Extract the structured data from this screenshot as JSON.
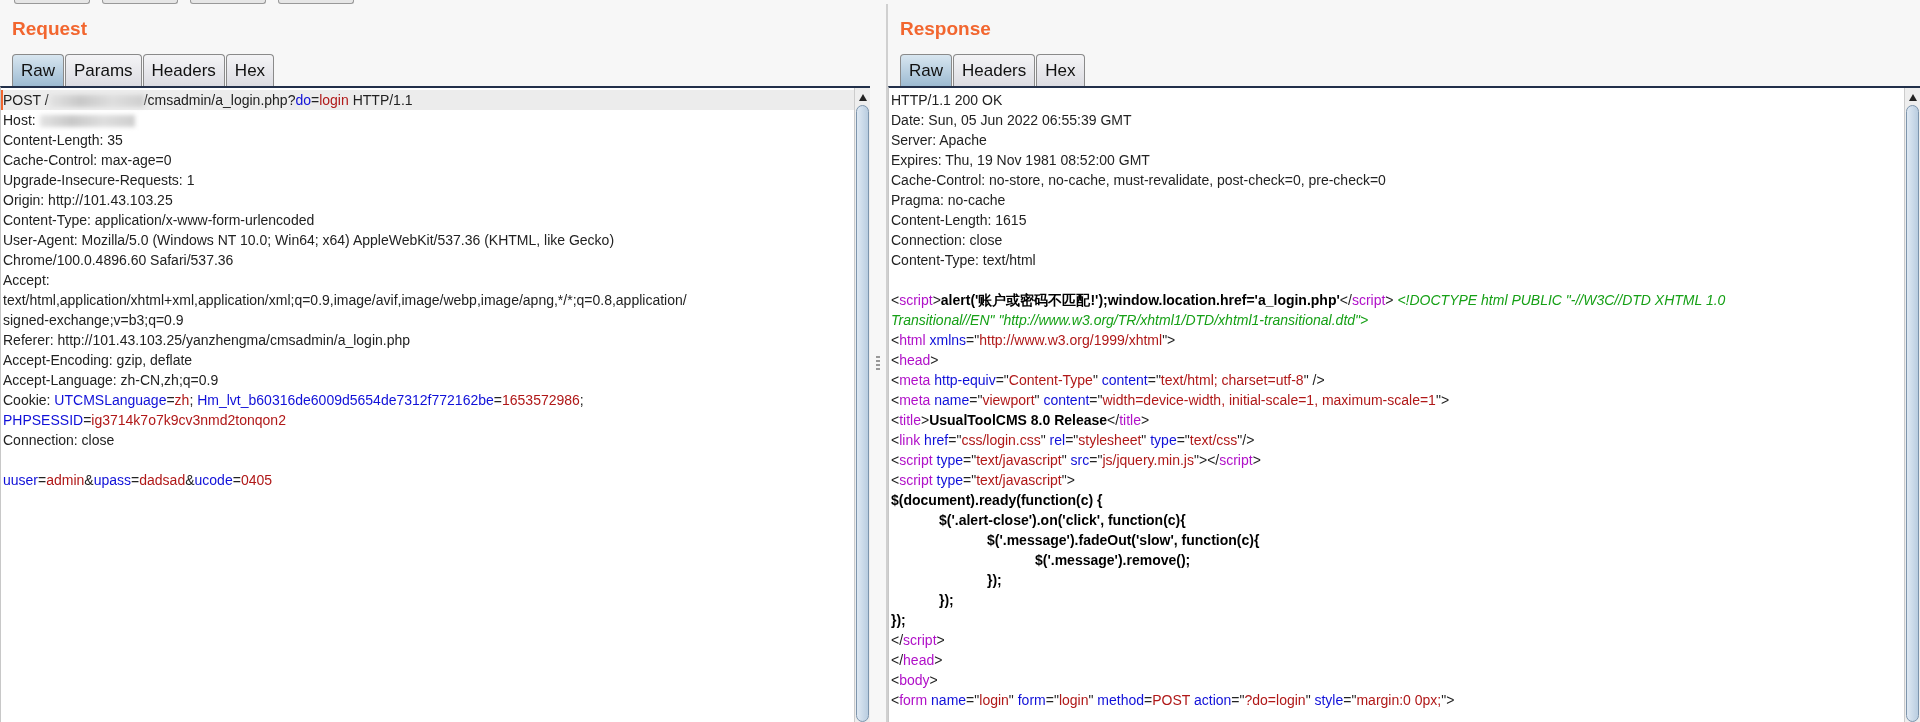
{
  "panes": [
    {
      "title": "Request",
      "tabs": [
        {
          "label": "Raw",
          "selected": true
        },
        {
          "label": "Params",
          "selected": false
        },
        {
          "label": "Headers",
          "selected": false
        },
        {
          "label": "Hex",
          "selected": false
        }
      ],
      "lines": [
        {
          "selected": true,
          "segs": [
            {
              "kind": "plain",
              "text": "POST /"
            },
            {
              "kind": "redacted"
            },
            {
              "kind": "plain",
              "text": "/cmsadmin/a_login.php?"
            },
            {
              "kind": "name",
              "text": "do"
            },
            {
              "kind": "plain",
              "text": "="
            },
            {
              "kind": "value",
              "text": "login"
            },
            {
              "kind": "plain",
              "text": " HTTP/1.1"
            }
          ]
        },
        {
          "selected": false,
          "segs": [
            {
              "kind": "plain",
              "text": "Host: "
            },
            {
              "kind": "redacted"
            }
          ]
        },
        {
          "selected": false,
          "segs": [
            {
              "kind": "plain",
              "text": "Content-Length: 35"
            }
          ]
        },
        {
          "selected": false,
          "segs": [
            {
              "kind": "plain",
              "text": "Cache-Control: max-age=0"
            }
          ]
        },
        {
          "selected": false,
          "segs": [
            {
              "kind": "plain",
              "text": "Upgrade-Insecure-Requests: 1"
            }
          ]
        },
        {
          "selected": false,
          "segs": [
            {
              "kind": "plain",
              "text": "Origin: http://101.43.103.25"
            }
          ]
        },
        {
          "selected": false,
          "segs": [
            {
              "kind": "plain",
              "text": "Content-Type: application/x-www-form-urlencoded"
            }
          ]
        },
        {
          "selected": false,
          "segs": [
            {
              "kind": "plain",
              "text": "User-Agent: Mozilla/5.0 (Windows NT 10.0; Win64; x64) AppleWebKit/537.36 (KHTML, like Gecko)"
            }
          ]
        },
        {
          "selected": false,
          "segs": [
            {
              "kind": "plain",
              "text": "Chrome/100.0.4896.60 Safari/537.36"
            }
          ]
        },
        {
          "selected": false,
          "segs": [
            {
              "kind": "plain",
              "text": "Accept:"
            }
          ]
        },
        {
          "selected": false,
          "segs": [
            {
              "kind": "plain",
              "text": "text/html,application/xhtml+xml,application/xml;q=0.9,image/avif,image/webp,image/apng,*/*;q=0.8,application/"
            }
          ]
        },
        {
          "selected": false,
          "segs": [
            {
              "kind": "plain",
              "text": "signed-exchange;v=b3;q=0.9"
            }
          ]
        },
        {
          "selected": false,
          "segs": [
            {
              "kind": "plain",
              "text": "Referer: http://101.43.103.25/yanzhengma/cmsadmin/a_login.php"
            }
          ]
        },
        {
          "selected": false,
          "segs": [
            {
              "kind": "plain",
              "text": "Accept-Encoding: gzip, deflate"
            }
          ]
        },
        {
          "selected": false,
          "segs": [
            {
              "kind": "plain",
              "text": "Accept-Language: zh-CN,zh;q=0.9"
            }
          ]
        },
        {
          "selected": false,
          "segs": [
            {
              "kind": "plain",
              "text": "Cookie: "
            },
            {
              "kind": "name",
              "text": "UTCMSLanguage"
            },
            {
              "kind": "plain",
              "text": "="
            },
            {
              "kind": "value",
              "text": "zh"
            },
            {
              "kind": "plain",
              "text": "; "
            },
            {
              "kind": "name",
              "text": "Hm_lvt_b60316de6009d5654de7312f772162be"
            },
            {
              "kind": "plain",
              "text": "="
            },
            {
              "kind": "value",
              "text": "1653572986"
            },
            {
              "kind": "plain",
              "text": ";"
            }
          ]
        },
        {
          "selected": false,
          "segs": [
            {
              "kind": "name",
              "text": "PHPSESSID"
            },
            {
              "kind": "plain",
              "text": "="
            },
            {
              "kind": "value",
              "text": "ig3714k7o7k9cv3nmd2tonqon2"
            }
          ]
        },
        {
          "selected": false,
          "segs": [
            {
              "kind": "plain",
              "text": "Connection: close"
            }
          ]
        },
        {
          "selected": false
        },
        {
          "selected": false,
          "segs": [
            {
              "kind": "name",
              "text": "uuser"
            },
            {
              "kind": "plain",
              "text": "="
            },
            {
              "kind": "value",
              "text": "admin"
            },
            {
              "kind": "plain",
              "text": "&"
            },
            {
              "kind": "name",
              "text": "upass"
            },
            {
              "kind": "plain",
              "text": "="
            },
            {
              "kind": "value",
              "text": "dadsad"
            },
            {
              "kind": "plain",
              "text": "&"
            },
            {
              "kind": "name",
              "text": "ucode"
            },
            {
              "kind": "plain",
              "text": "="
            },
            {
              "kind": "value",
              "text": "0405"
            }
          ]
        }
      ]
    },
    {
      "title": "Response",
      "tabs": [
        {
          "label": "Raw",
          "selected": true
        },
        {
          "label": "Headers",
          "selected": false
        },
        {
          "label": "Hex",
          "selected": false
        }
      ],
      "lines": [
        {
          "selected": false,
          "segs": [
            {
              "kind": "plain",
              "text": "HTTP/1.1 200 OK"
            }
          ]
        },
        {
          "selected": false,
          "segs": [
            {
              "kind": "plain",
              "text": "Date: Sun, 05 Jun 2022 06:55:39 GMT"
            }
          ]
        },
        {
          "selected": false,
          "segs": [
            {
              "kind": "plain",
              "text": "Server: Apache"
            }
          ]
        },
        {
          "selected": false,
          "segs": [
            {
              "kind": "plain",
              "text": "Expires: Thu, 19 Nov 1981 08:52:00 GMT"
            }
          ]
        },
        {
          "selected": false,
          "segs": [
            {
              "kind": "plain",
              "text": "Cache-Control: no-store, no-cache, must-revalidate, post-check=0, pre-check=0"
            }
          ]
        },
        {
          "selected": false,
          "segs": [
            {
              "kind": "plain",
              "text": "Pragma: no-cache"
            }
          ]
        },
        {
          "selected": false,
          "segs": [
            {
              "kind": "plain",
              "text": "Content-Length: 1615"
            }
          ]
        },
        {
          "selected": false,
          "segs": [
            {
              "kind": "plain",
              "text": "Connection: close"
            }
          ]
        },
        {
          "selected": false,
          "segs": [
            {
              "kind": "plain",
              "text": "Content-Type: text/html"
            }
          ]
        },
        {
          "selected": false
        },
        {
          "selected": false,
          "segs": [
            {
              "kind": "plain",
              "text": "<"
            },
            {
              "kind": "tag",
              "text": "script"
            },
            {
              "kind": "plain",
              "text": ">"
            },
            {
              "kind": "bold",
              "text": "alert('账户或密码不匹配!');window.location.href='a_login.php'"
            },
            {
              "kind": "plain",
              "text": "</"
            },
            {
              "kind": "tag",
              "text": "script"
            },
            {
              "kind": "plain",
              "text": "> "
            },
            {
              "kind": "comment",
              "text": "<!DOCTYPE html PUBLIC \"-//W3C//DTD XHTML 1.0"
            }
          ]
        },
        {
          "selected": false,
          "segs": [
            {
              "kind": "comment",
              "text": "Transitional//EN\" \"http://www.w3.org/TR/xhtml1/DTD/xhtml1-transitional.dtd\">"
            }
          ]
        },
        {
          "selected": false,
          "segs": [
            {
              "kind": "plain",
              "text": "<"
            },
            {
              "kind": "tag",
              "text": "html "
            },
            {
              "kind": "name",
              "text": "xmlns"
            },
            {
              "kind": "plain",
              "text": "=\""
            },
            {
              "kind": "value",
              "text": "http://www.w3.org/1999/xhtml"
            },
            {
              "kind": "plain",
              "text": "\">"
            }
          ]
        },
        {
          "selected": false,
          "segs": [
            {
              "kind": "plain",
              "text": "<"
            },
            {
              "kind": "tag",
              "text": "head"
            },
            {
              "kind": "plain",
              "text": ">"
            }
          ]
        },
        {
          "selected": false,
          "segs": [
            {
              "kind": "plain",
              "text": "<"
            },
            {
              "kind": "tag",
              "text": "meta "
            },
            {
              "kind": "name",
              "text": "http-equiv"
            },
            {
              "kind": "plain",
              "text": "=\""
            },
            {
              "kind": "value",
              "text": "Content-Type"
            },
            {
              "kind": "plain",
              "text": "\" "
            },
            {
              "kind": "name",
              "text": "content"
            },
            {
              "kind": "plain",
              "text": "=\""
            },
            {
              "kind": "value",
              "text": "text/html; charset=utf-8"
            },
            {
              "kind": "plain",
              "text": "\" />"
            }
          ]
        },
        {
          "selected": false,
          "segs": [
            {
              "kind": "plain",
              "text": "<"
            },
            {
              "kind": "tag",
              "text": "meta "
            },
            {
              "kind": "name",
              "text": "name"
            },
            {
              "kind": "plain",
              "text": "=\""
            },
            {
              "kind": "value",
              "text": "viewport"
            },
            {
              "kind": "plain",
              "text": "\" "
            },
            {
              "kind": "name",
              "text": "content"
            },
            {
              "kind": "plain",
              "text": "=\""
            },
            {
              "kind": "value",
              "text": "width=device-width, initial-scale=1, maximum-scale=1"
            },
            {
              "kind": "plain",
              "text": "\">"
            }
          ]
        },
        {
          "selected": false,
          "segs": [
            {
              "kind": "plain",
              "text": "<"
            },
            {
              "kind": "tag",
              "text": "title"
            },
            {
              "kind": "plain",
              "text": ">"
            },
            {
              "kind": "bold",
              "text": "UsualToolCMS 8.0 Release"
            },
            {
              "kind": "plain",
              "text": "</"
            },
            {
              "kind": "tag",
              "text": "title"
            },
            {
              "kind": "plain",
              "text": ">"
            }
          ]
        },
        {
          "selected": false,
          "segs": [
            {
              "kind": "plain",
              "text": "<"
            },
            {
              "kind": "tag",
              "text": "link "
            },
            {
              "kind": "name",
              "text": "href"
            },
            {
              "kind": "plain",
              "text": "=\""
            },
            {
              "kind": "value",
              "text": "css/login.css"
            },
            {
              "kind": "plain",
              "text": "\" "
            },
            {
              "kind": "name",
              "text": "rel"
            },
            {
              "kind": "plain",
              "text": "=\""
            },
            {
              "kind": "value",
              "text": "stylesheet"
            },
            {
              "kind": "plain",
              "text": "\" "
            },
            {
              "kind": "name",
              "text": "type"
            },
            {
              "kind": "plain",
              "text": "=\""
            },
            {
              "kind": "value",
              "text": "text/css"
            },
            {
              "kind": "plain",
              "text": "\"/>"
            }
          ]
        },
        {
          "selected": false,
          "segs": [
            {
              "kind": "plain",
              "text": "<"
            },
            {
              "kind": "tag",
              "text": "script "
            },
            {
              "kind": "name",
              "text": "type"
            },
            {
              "kind": "plain",
              "text": "=\""
            },
            {
              "kind": "value",
              "text": "text/javascript"
            },
            {
              "kind": "plain",
              "text": "\" "
            },
            {
              "kind": "name",
              "text": "src"
            },
            {
              "kind": "plain",
              "text": "=\""
            },
            {
              "kind": "value",
              "text": "js/jquery.min.js"
            },
            {
              "kind": "plain",
              "text": "\"></"
            },
            {
              "kind": "tag",
              "text": "script"
            },
            {
              "kind": "plain",
              "text": ">"
            }
          ]
        },
        {
          "selected": false,
          "segs": [
            {
              "kind": "plain",
              "text": "<"
            },
            {
              "kind": "tag",
              "text": "script "
            },
            {
              "kind": "name",
              "text": "type"
            },
            {
              "kind": "plain",
              "text": "=\""
            },
            {
              "kind": "value",
              "text": "text/javascript"
            },
            {
              "kind": "plain",
              "text": "\">"
            }
          ]
        },
        {
          "selected": false,
          "segs": [
            {
              "kind": "bold",
              "text": "$(document).ready(function(c) {"
            }
          ]
        },
        {
          "selected": false,
          "segs": [
            {
              "kind": "bold",
              "text": "\t$('.alert-close').on('click', function(c){"
            }
          ]
        },
        {
          "selected": false,
          "segs": [
            {
              "kind": "bold",
              "text": "\t\t$('.message').fadeOut('slow', function(c){"
            }
          ]
        },
        {
          "selected": false,
          "segs": [
            {
              "kind": "bold",
              "text": "\t\t\t$('.message').remove();"
            }
          ]
        },
        {
          "selected": false,
          "segs": [
            {
              "kind": "bold",
              "text": "\t\t});"
            }
          ]
        },
        {
          "selected": false,
          "segs": [
            {
              "kind": "bold",
              "text": "\t});"
            }
          ]
        },
        {
          "selected": false,
          "segs": [
            {
              "kind": "bold",
              "text": "});"
            }
          ]
        },
        {
          "selected": false,
          "segs": [
            {
              "kind": "plain",
              "text": "</"
            },
            {
              "kind": "tag",
              "text": "script"
            },
            {
              "kind": "plain",
              "text": ">"
            }
          ]
        },
        {
          "selected": false,
          "segs": [
            {
              "kind": "plain",
              "text": "</"
            },
            {
              "kind": "tag",
              "text": "head"
            },
            {
              "kind": "plain",
              "text": ">"
            }
          ]
        },
        {
          "selected": false,
          "segs": [
            {
              "kind": "plain",
              "text": "<"
            },
            {
              "kind": "tag",
              "text": "body"
            },
            {
              "kind": "plain",
              "text": ">"
            }
          ]
        },
        {
          "selected": false,
          "segs": [
            {
              "kind": "plain",
              "text": "<"
            },
            {
              "kind": "tag",
              "text": "form "
            },
            {
              "kind": "name",
              "text": "name"
            },
            {
              "kind": "plain",
              "text": "=\""
            },
            {
              "kind": "value",
              "text": "login"
            },
            {
              "kind": "plain",
              "text": "\" "
            },
            {
              "kind": "name",
              "text": "form"
            },
            {
              "kind": "plain",
              "text": "=\""
            },
            {
              "kind": "value",
              "text": "login"
            },
            {
              "kind": "plain",
              "text": "\" "
            },
            {
              "kind": "name",
              "text": "method"
            },
            {
              "kind": "plain",
              "text": "="
            },
            {
              "kind": "value",
              "text": "POST "
            },
            {
              "kind": "name",
              "text": "action"
            },
            {
              "kind": "plain",
              "text": "=\""
            },
            {
              "kind": "value",
              "text": "?do=login"
            },
            {
              "kind": "plain",
              "text": "\" "
            },
            {
              "kind": "name",
              "text": "style"
            },
            {
              "kind": "plain",
              "text": "=\""
            },
            {
              "kind": "value",
              "text": "margin:0 0px;"
            },
            {
              "kind": "plain",
              "text": "\">"
            }
          ]
        }
      ]
    }
  ]
}
